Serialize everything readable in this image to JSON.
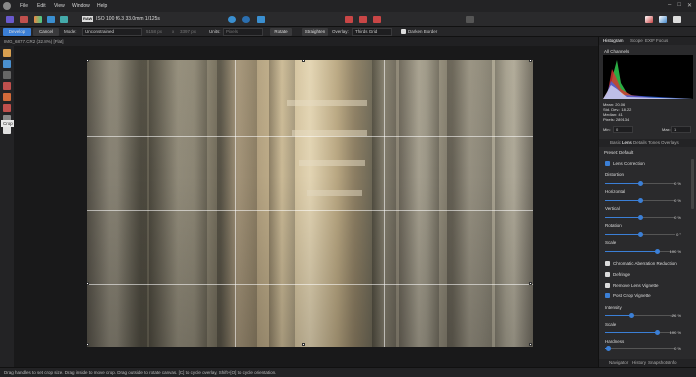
{
  "menu": {
    "file": "File",
    "edit": "Edit",
    "view": "View",
    "window": "Window",
    "help": "Help"
  },
  "toolbar": {
    "raw_badge": "RAW",
    "camera_info": "ISO 100 f6.3 33.0mm 1/125s"
  },
  "context": {
    "develop": "Develop",
    "cancel": "Cancel",
    "mode_label": "Mode:",
    "mode_value": "Unconstrained",
    "w_value": "5158 px",
    "x_sep": "x",
    "h_value": "3397 px",
    "units_label": "Units:",
    "units_value": "Pixels",
    "rotate": "Rotate",
    "straighten": "Straighten",
    "overlay_label": "Overlay:",
    "overlay_value": "Thirds Grid",
    "darken": "Darken Border"
  },
  "doc": {
    "tab_title": "IMG_6877.CR2 (32.8%) [Flat]"
  },
  "tooltip": "Crop Tool (C)",
  "status": "Drag handles to set crop size. Drag inside to move crop. Drag outside to rotate canvas. [C] to cycle overlay, Shift+[O] to cycle orientation.",
  "panel": {
    "tabs": [
      "Histogram",
      "Scope",
      "EXIF",
      "Focus"
    ],
    "channel": "All Channels",
    "stats": {
      "mean": "Mean: 20.06",
      "std": "Std. Dev.: 18.22",
      "median": "Median: 41",
      "pixels": "Pixels: 289134"
    },
    "min_label": "Min:",
    "min_value": "0",
    "max_label": "Max:",
    "max_value": "1",
    "dev_tabs": [
      "Basic",
      "Lens",
      "Details",
      "Tones",
      "Overlays"
    ],
    "preset_label": "Preset:",
    "preset_value": "Default",
    "lens_correction": "Lens Correction",
    "distortion": "Distortion",
    "distortion_val": "0 %",
    "horizontal": "Horizontal",
    "horizontal_val": "0 %",
    "vertical": "Vertical",
    "vertical_val": "0 %",
    "rotation": "Rotation",
    "rotation_val": "0 °",
    "scale": "Scale",
    "scale_val": "100 %",
    "chromatic": "Chromatic Aberration Reduction",
    "defringe": "Defringe",
    "remove_vignette": "Remove Lens Vignette",
    "post_crop": "Post Crop Vignette",
    "intensity": "Intensity",
    "intensity_val": "-26 %",
    "scale2": "Scale",
    "scale2_val": "100 %",
    "hardness": "Hardness",
    "hardness_val": "0 %",
    "bottom_tabs": [
      "Navigator",
      "History",
      "Snapshots",
      "Info"
    ]
  },
  "colors": {
    "accent": "#3b7fd6",
    "develop_btn": "#3b7fd6"
  }
}
